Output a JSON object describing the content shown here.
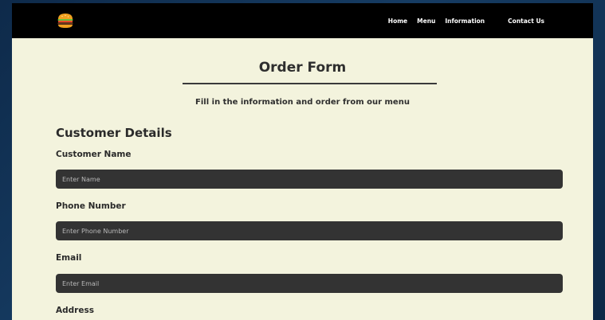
{
  "nav": {
    "logo_icon": "burger-icon",
    "links": [
      {
        "label": "Home"
      },
      {
        "label": "Menu"
      },
      {
        "label": "Information"
      },
      {
        "label": "Contact Us"
      }
    ]
  },
  "form": {
    "title": "Order Form",
    "subtitle": "Fill in the information and order from our menu",
    "section_heading": "Customer Details",
    "fields": [
      {
        "label": "Customer Name",
        "placeholder": "Enter Name",
        "value": ""
      },
      {
        "label": "Phone Number",
        "placeholder": "Enter Phone Number",
        "value": ""
      },
      {
        "label": "Email",
        "placeholder": "Enter Email",
        "value": ""
      },
      {
        "label": "Address"
      }
    ]
  },
  "colors": {
    "navbar": "#000000",
    "page_background": "#f3f3dd",
    "input_background": "#333333",
    "text": "#2a2a2a"
  }
}
